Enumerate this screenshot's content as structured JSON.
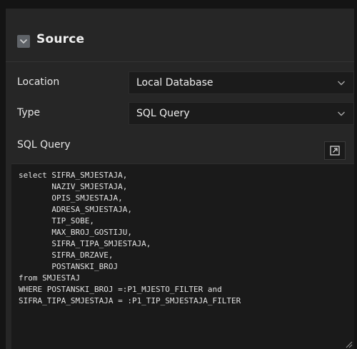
{
  "section": {
    "title": "Source",
    "collapse_icon": "chevron-down-icon"
  },
  "location": {
    "label": "Location",
    "value": "Local Database"
  },
  "type": {
    "label": "Type",
    "value": "SQL Query"
  },
  "sql_query": {
    "label": "SQL Query",
    "expand_icon": "expand-icon",
    "lines": [
      "select SIFRA_SMJESTAJA,",
      "       NAZIV_SMJESTAJA,",
      "       OPIS_SMJESTAJA,",
      "       ADRESA_SMJESTAJA,",
      "       TIP_SOBE,",
      "       MAX_BROJ_GOSTIJU,",
      "       SIFRA_TIPA_SMJESTAJA,",
      "       SIFRA_DRZAVE,",
      "       POSTANSKI_BROJ",
      "from SMJESTAJ",
      "WHERE POSTANSKI_BROJ =:P1_MJESTO_FILTER and",
      "SIFRA_TIPA_SMJESTAJA = :P1_TIP_SMJESTAJA_FILTER"
    ]
  },
  "colors": {
    "background": "#262626",
    "field_background": "#1b1b1b",
    "text": "#e6e6e6"
  }
}
